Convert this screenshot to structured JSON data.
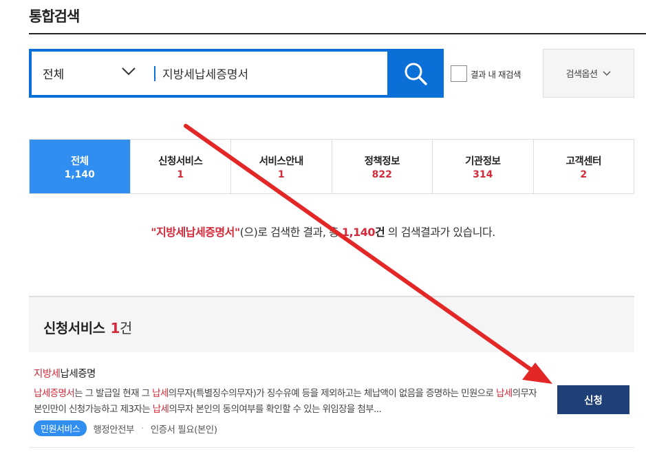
{
  "page": {
    "title": "통합검색"
  },
  "search": {
    "scope": "전체",
    "query": "지방세납세증명서",
    "within_label": "결과 내 재검색",
    "options_label": "검색옵션"
  },
  "tabs": [
    {
      "label": "전체",
      "count": "1,140",
      "active": true
    },
    {
      "label": "신청서비스",
      "count": "1"
    },
    {
      "label": "서비스안내",
      "count": "1"
    },
    {
      "label": "정책정보",
      "count": "822"
    },
    {
      "label": "기관정보",
      "count": "314"
    },
    {
      "label": "고객센터",
      "count": "2"
    }
  ],
  "summary": {
    "keyword": "\"지방세납세증명서\"",
    "text1": "(으)로 검색한 결과, 총 ",
    "count": "1,140",
    "unit": "건",
    "text2": " 의 검색결과가 있습니다."
  },
  "section": {
    "title": "신청서비스",
    "count": "1",
    "unit": "건"
  },
  "result": {
    "title_hl": "지방세",
    "title_rest": "납세증명",
    "desc": [
      {
        "t": "납세증명서",
        "hl": true
      },
      {
        "t": "는 그 발급일 현재 그 "
      },
      {
        "t": "납세",
        "hl": true
      },
      {
        "t": "의무자(특별징수의무자)가 징수유예 등을 제외하고는 체납액이 없음을 증명하는 민원으로 "
      },
      {
        "t": "납세",
        "hl": true
      },
      {
        "t": "의무자 본인만이 신청가능하고 제3자는 "
      },
      {
        "t": "납세",
        "hl": true
      },
      {
        "t": "의무자 본인의 동의여부를 확인할 수 있는 위임장을 첨부..."
      }
    ],
    "tag": "민원서비스",
    "agency": "행정안전부",
    "cert": "인증서 필요(본인)",
    "apply_label": "신청"
  },
  "colors": {
    "primary_blue": "#0b6fd8",
    "active_tab": "#2f8ef0",
    "highlight_red": "#d32a3a",
    "apply_navy": "#1f3f77",
    "annotation_arrow": "#e32626"
  }
}
